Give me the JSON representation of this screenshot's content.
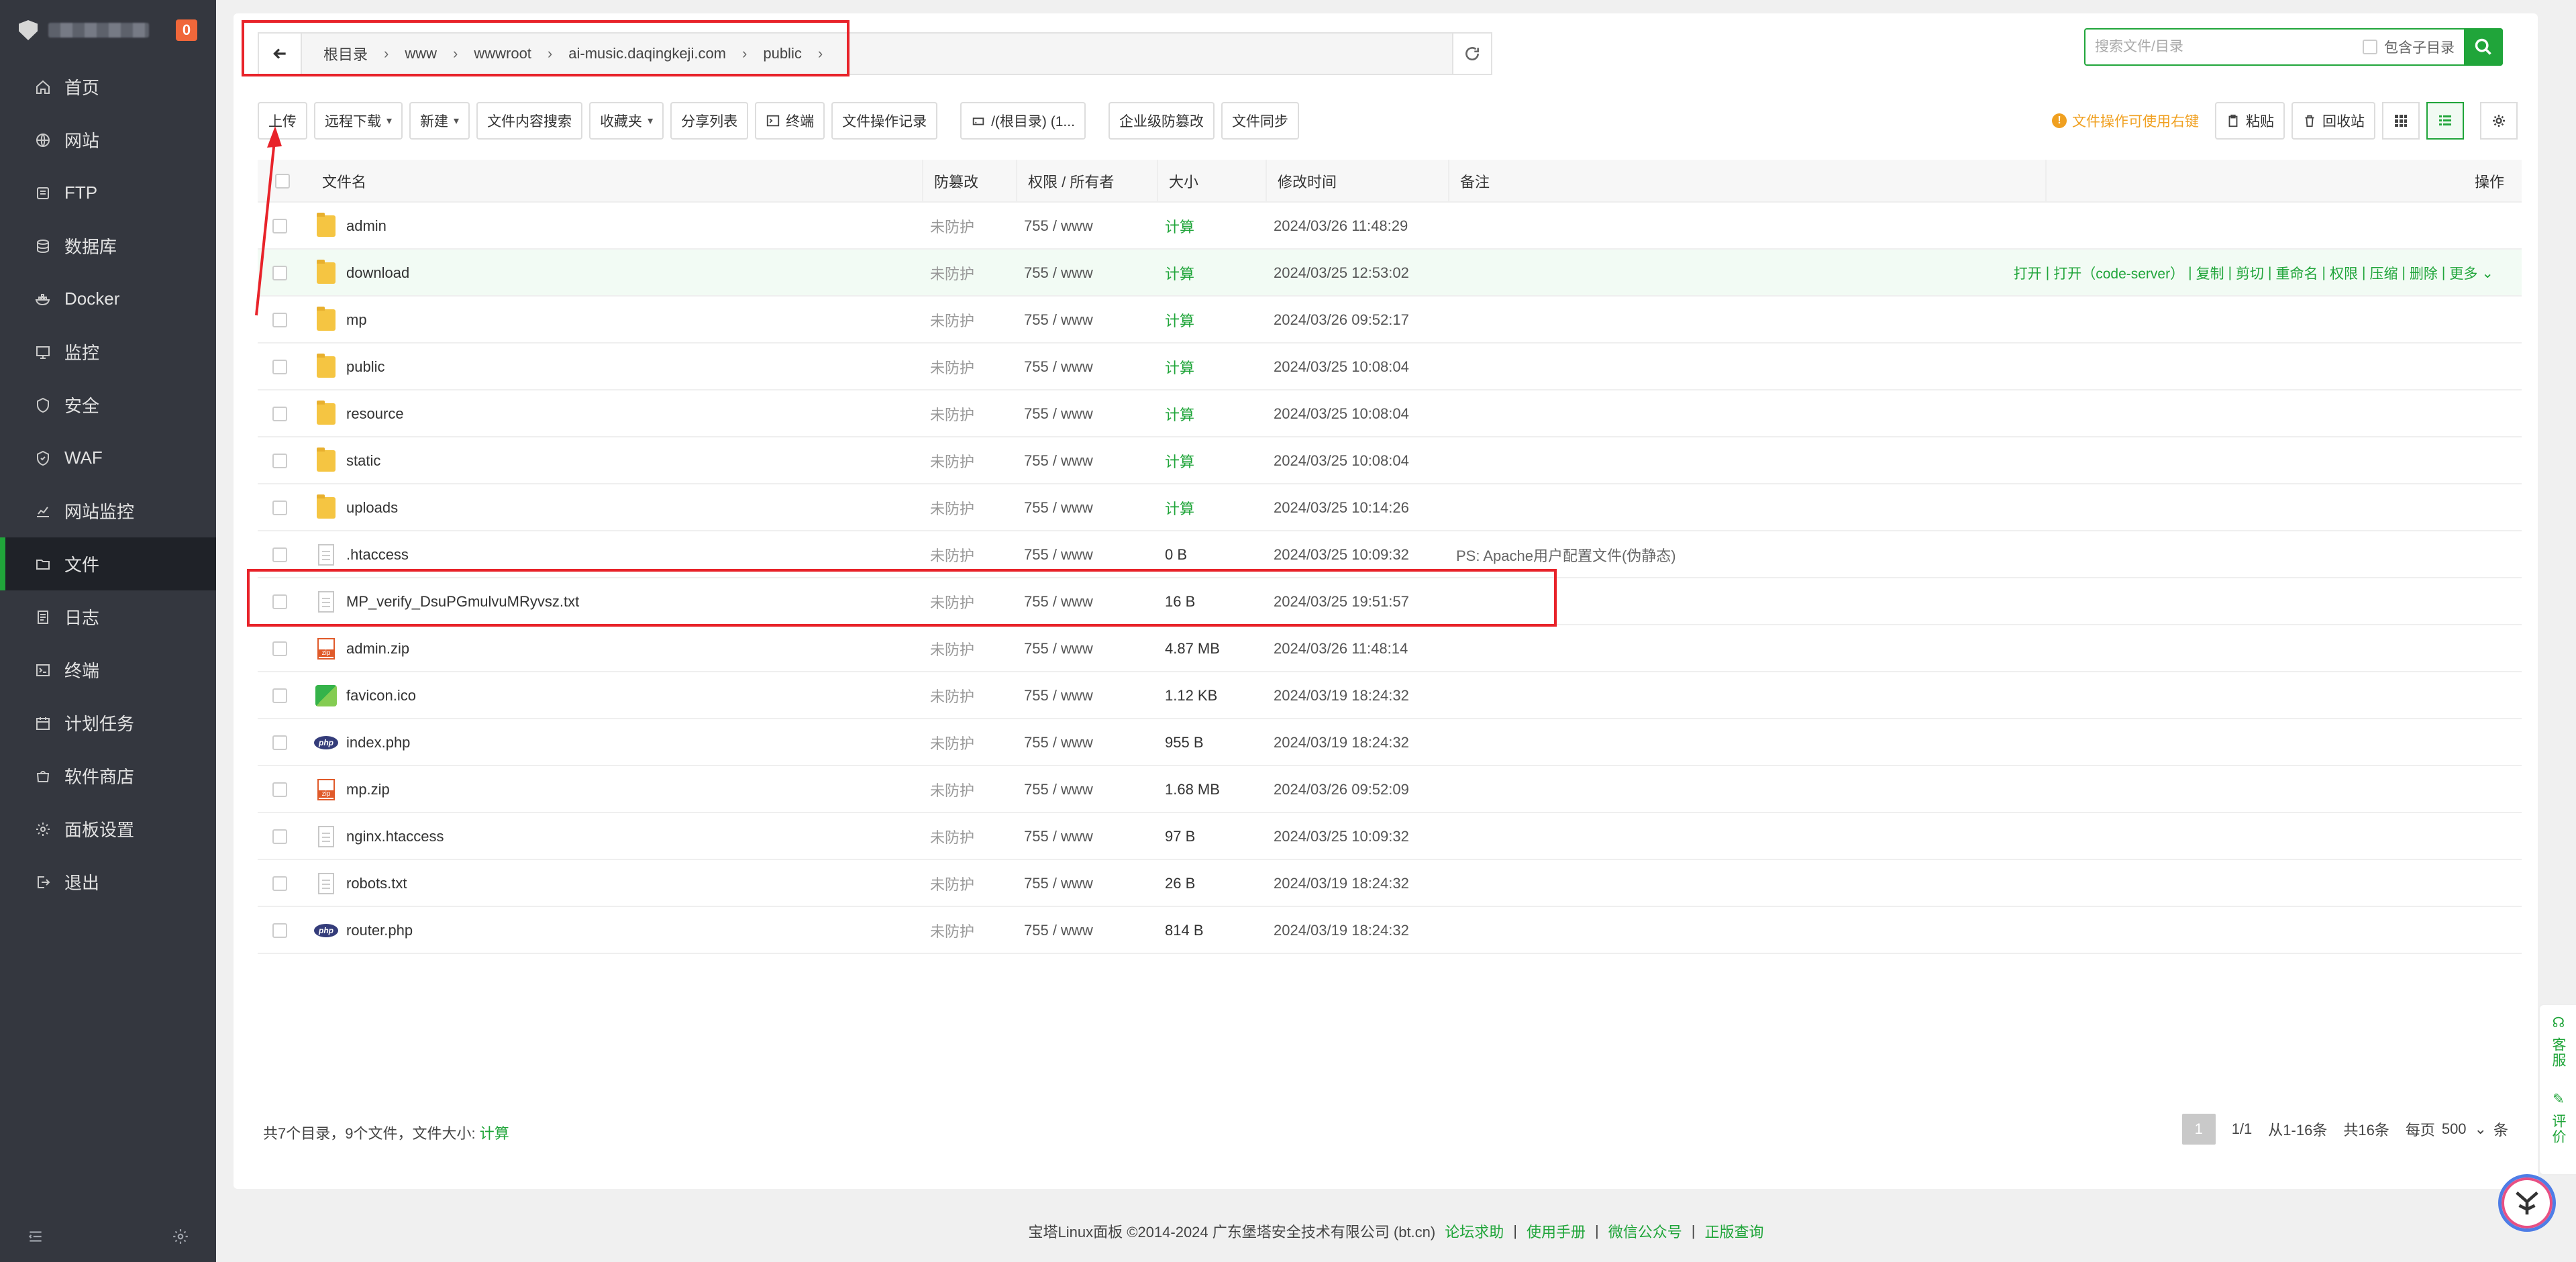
{
  "sidebar": {
    "badge": "0",
    "items": [
      {
        "label": "首页",
        "icon": "home-icon"
      },
      {
        "label": "网站",
        "icon": "globe-icon"
      },
      {
        "label": "FTP",
        "icon": "ftp-icon"
      },
      {
        "label": "数据库",
        "icon": "database-icon"
      },
      {
        "label": "Docker",
        "icon": "docker-icon"
      },
      {
        "label": "监控",
        "icon": "monitor-icon"
      },
      {
        "label": "安全",
        "icon": "shield-icon"
      },
      {
        "label": "WAF",
        "icon": "waf-icon"
      },
      {
        "label": "网站监控",
        "icon": "chart-icon"
      },
      {
        "label": "文件",
        "icon": "folder-icon",
        "active": true
      },
      {
        "label": "日志",
        "icon": "log-icon"
      },
      {
        "label": "终端",
        "icon": "terminal-icon"
      },
      {
        "label": "计划任务",
        "icon": "calendar-icon"
      },
      {
        "label": "软件商店",
        "icon": "store-icon"
      },
      {
        "label": "面板设置",
        "icon": "gear-icon"
      },
      {
        "label": "退出",
        "icon": "logout-icon"
      }
    ]
  },
  "path": {
    "crumbs": [
      "根目录",
      "www",
      "wwwroot",
      "ai-music.daqingkeji.com",
      "public"
    ]
  },
  "search": {
    "placeholder": "搜索文件/目录",
    "subdir_label": "包含子目录"
  },
  "toolbar": {
    "upload": "上传",
    "remote_download": "远程下载",
    "new": "新建",
    "content_search": "文件内容搜索",
    "favorites": "收藏夹",
    "share_list": "分享列表",
    "terminal": "终端",
    "op_log": "文件操作记录",
    "disk": "/(根目录) (1...",
    "tamper": "企业级防篡改",
    "sync": "文件同步",
    "tip": "文件操作可使用右键",
    "paste": "粘贴",
    "recycle": "回收站"
  },
  "table": {
    "headers": {
      "name": "文件名",
      "protect": "防篡改",
      "perm": "权限 / 所有者",
      "size": "大小",
      "mtime": "修改时间",
      "note": "备注",
      "ops": "操作"
    },
    "ops": [
      "打开",
      "打开（code-server）",
      "复制",
      "剪切",
      "重命名",
      "权限",
      "压缩",
      "删除",
      "更多"
    ],
    "rows": [
      {
        "name": "admin",
        "type": "folder",
        "protect": "未防护",
        "perm": "755 / www",
        "size": "计算",
        "mtime": "2024/03/26 11:48:29",
        "note": ""
      },
      {
        "name": "download",
        "type": "folder",
        "protect": "未防护",
        "perm": "755 / www",
        "size": "计算",
        "mtime": "2024/03/25 12:53:02",
        "note": ""
      },
      {
        "name": "mp",
        "type": "folder",
        "protect": "未防护",
        "perm": "755 / www",
        "size": "计算",
        "mtime": "2024/03/26 09:52:17",
        "note": ""
      },
      {
        "name": "public",
        "type": "folder",
        "protect": "未防护",
        "perm": "755 / www",
        "size": "计算",
        "mtime": "2024/03/25 10:08:04",
        "note": ""
      },
      {
        "name": "resource",
        "type": "folder",
        "protect": "未防护",
        "perm": "755 / www",
        "size": "计算",
        "mtime": "2024/03/25 10:08:04",
        "note": ""
      },
      {
        "name": "static",
        "type": "folder",
        "protect": "未防护",
        "perm": "755 / www",
        "size": "计算",
        "mtime": "2024/03/25 10:08:04",
        "note": ""
      },
      {
        "name": "uploads",
        "type": "folder",
        "protect": "未防护",
        "perm": "755 / www",
        "size": "计算",
        "mtime": "2024/03/25 10:14:26",
        "note": ""
      },
      {
        "name": ".htaccess",
        "type": "doc",
        "protect": "未防护",
        "perm": "755 / www",
        "size": "0 B",
        "mtime": "2024/03/25 10:09:32",
        "note": "PS: Apache用户配置文件(伪静态)"
      },
      {
        "name": "MP_verify_DsuPGmulvuMRyvsz.txt",
        "type": "doc",
        "protect": "未防护",
        "perm": "755 / www",
        "size": "16 B",
        "mtime": "2024/03/25 19:51:57",
        "note": ""
      },
      {
        "name": "admin.zip",
        "type": "zip",
        "protect": "未防护",
        "perm": "755 / www",
        "size": "4.87 MB",
        "mtime": "2024/03/26 11:48:14",
        "note": ""
      },
      {
        "name": "favicon.ico",
        "type": "ico",
        "protect": "未防护",
        "perm": "755 / www",
        "size": "1.12 KB",
        "mtime": "2024/03/19 18:24:32",
        "note": ""
      },
      {
        "name": "index.php",
        "type": "php",
        "protect": "未防护",
        "perm": "755 / www",
        "size": "955 B",
        "mtime": "2024/03/19 18:24:32",
        "note": ""
      },
      {
        "name": "mp.zip",
        "type": "zip",
        "protect": "未防护",
        "perm": "755 / www",
        "size": "1.68 MB",
        "mtime": "2024/03/26 09:52:09",
        "note": ""
      },
      {
        "name": "nginx.htaccess",
        "type": "doc",
        "protect": "未防护",
        "perm": "755 / www",
        "size": "97 B",
        "mtime": "2024/03/25 10:09:32",
        "note": ""
      },
      {
        "name": "robots.txt",
        "type": "doc",
        "protect": "未防护",
        "perm": "755 / www",
        "size": "26 B",
        "mtime": "2024/03/19 18:24:32",
        "note": ""
      },
      {
        "name": "router.php",
        "type": "php",
        "protect": "未防护",
        "perm": "755 / www",
        "size": "814 B",
        "mtime": "2024/03/19 18:24:32",
        "note": ""
      }
    ]
  },
  "summary": {
    "text": "共7个目录，9个文件，文件大小:",
    "calc": "计算"
  },
  "pager": {
    "current": "1",
    "pages": "1/1",
    "range": "从1-16条",
    "total": "共16条",
    "per_label": "每页",
    "per_value": "500",
    "unit": "条"
  },
  "footer": {
    "copyright": "宝塔Linux面板 ©2014-2024 广东堡塔安全技术有限公司 (bt.cn)",
    "links": [
      "论坛求助",
      "使用手册",
      "微信公众号",
      "正版查询"
    ]
  },
  "float": {
    "service": "客服",
    "rate": "评价"
  },
  "colors": {
    "accent": "#20a53a",
    "sidebar": "#34373f",
    "annotation": "#e8232a",
    "warning": "#f0a020"
  }
}
